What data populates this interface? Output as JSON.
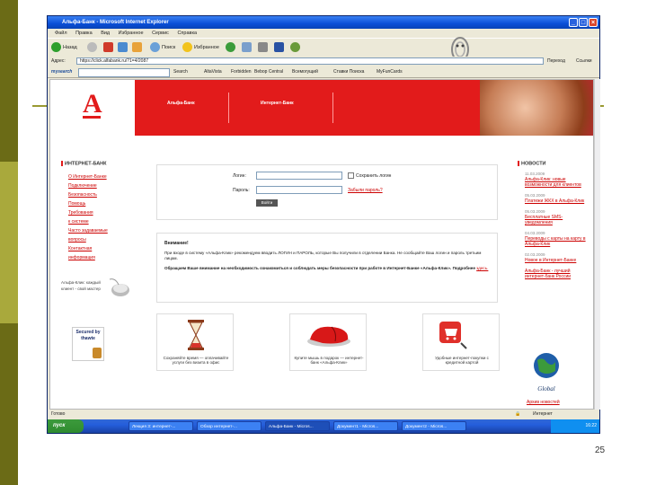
{
  "window": {
    "title": "Альфа-Банк - Microsoft Internet Explorer",
    "menu": [
      "Файл",
      "Правка",
      "Вид",
      "Избранное",
      "Сервис",
      "Справка"
    ],
    "toolbar": {
      "back": "Назад",
      "search": "Поиск",
      "favorites": "Избранное"
    },
    "address_label": "Адрес:",
    "address_value": "https://click.alfabank.ru/?1=4/2087",
    "go_label": "Переход",
    "links_label": "Ссылки",
    "links": [
      "Search",
      "AltaVista",
      "Forbidden",
      "Bebop Central",
      "Всемогущий",
      "Ставки Поиска",
      "MyFunCards"
    ]
  },
  "header": {
    "tab1": "Альфа-Банк",
    "tab2": "Интернет-Банк"
  },
  "sidebar": {
    "title": "ИНТЕРНЕТ-БАНК",
    "items": [
      "О Интернет-Банке",
      "Подключение",
      "Безопасность",
      "Помощь",
      "Требования",
      "к системе",
      "Часто задаваемые",
      "вопросы",
      "Контактная",
      "информация"
    ],
    "promo": "Альфа-Клик: каждый клиент - свой мастер",
    "secured_text": "Secured by thawte"
  },
  "login": {
    "login_label": "Логин:",
    "password_label": "Пароль:",
    "remember": "Сохранить логин",
    "forgot": "Забыли пароль?",
    "button": "Войти"
  },
  "notice": {
    "title": "Внимание!",
    "p1": "При входе в систему «Альфа-Клик» рекомендуем вводить ЛОГИН и ПАРОЛЬ, которые Вы получили в отделении Банка. Не сообщайте Ваш логин и пароль третьим лицам.",
    "p2": "Обращаем Ваше внимание на необходимость ознакомиться и соблюдать меры безопасности при работе в Интернет-Банке «Альфа-Клик». Подробнее",
    "p2_link": "здесь."
  },
  "cards": [
    {
      "caption": "Сохраняйте время — оплачивайте услуги без визита в офис"
    },
    {
      "caption": "Купите мышь в подарок — интернет-банк «Альфа-Клик»"
    },
    {
      "caption": "Удобные интернет-покупки с кредитной картой"
    }
  ],
  "news": {
    "title": "НОВОСТИ",
    "items": [
      {
        "date": "11.03.2009",
        "text": "Альфа-Клик: новые возможности для клиентов"
      },
      {
        "date": "05.03.2009",
        "text": "Платежи ЖКХ в Альфа-Клик"
      },
      {
        "date": "05.03.2009",
        "text": "Бесплатные SMS-уведомления"
      },
      {
        "date": "04.03.2009",
        "text": "Переводы с карты на карту в Альфа-Клик"
      },
      {
        "date": "02.03.2009",
        "text": "Новое в Интернет-Банке"
      }
    ],
    "award_caption": "Альфа-Банк - лучший интернет-банк России",
    "bottom_link": "Архив новостей"
  },
  "status": {
    "left": "Готово",
    "zone": "Интернет"
  },
  "taskbar": {
    "start": "пуск",
    "tasks": [
      "Лекция 3: интернет-...",
      "Обзор интернет-...",
      "Альфа-Банк - Micros...",
      "Документ1 - Micros...",
      "Документ2 - Micros..."
    ],
    "time": "16:22"
  },
  "slide": {
    "page_number": "25"
  }
}
